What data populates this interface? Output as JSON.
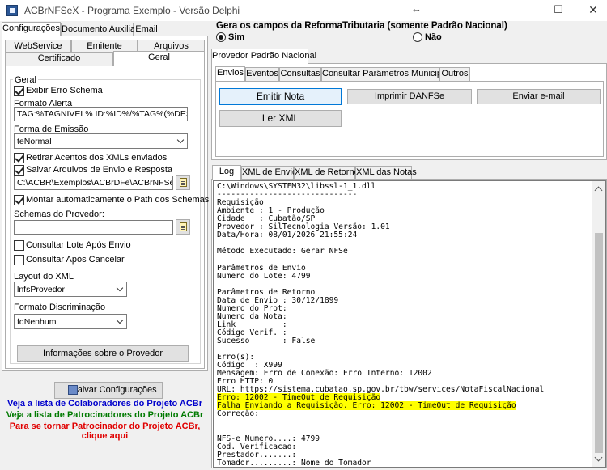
{
  "window": {
    "title": "ACBrNFSeX - Programa Exemplo - Versão Delphi",
    "resize_glyph": "↔",
    "minimize": "—",
    "maximize": "☐",
    "close": "✕"
  },
  "left": {
    "top_tabs": [
      "Configurações",
      "Documento Auxiliar",
      "Email"
    ],
    "sub_tabs_row1": [
      "WebService",
      "Emitente",
      "Arquivos"
    ],
    "sub_tabs_row2": [
      "Certificado",
      "Geral"
    ],
    "group_title": "Geral",
    "exibir_erro_schema": "Exibir Erro Schema",
    "formato_alerta_label": "Formato Alerta",
    "formato_alerta_value": "TAG:%TAGNIVEL% ID:%ID%/%TAG%(%DESCRI",
    "forma_emissao_label": "Forma de Emissão",
    "forma_emissao_value": "teNormal",
    "retirar_acentos": "Retirar Acentos dos XMLs enviados",
    "salvar_arquivos": "Salvar Arquivos de Envio e Resposta",
    "path_value": "C:\\ACBR\\Exemplos\\ACBrDFe\\ACBrNFSeX\\Delp",
    "montar_path": "Montar automaticamente o Path dos Schemas",
    "schemas_label": "Schemas do Provedor:",
    "schemas_value": "",
    "consultar_lote": "Consultar Lote Após Envio",
    "consultar_apos_cancelar": "Consultar Após Cancelar",
    "layout_xml_label": "Layout do XML",
    "layout_xml_value": "lnfsProvedor",
    "formato_discriminacao_label": "Formato Discriminação",
    "formato_discriminacao_value": "fdNenhum",
    "info_provedor_button": "Informações sobre o Provedor",
    "salvar_config_button": "Salvar Configurações",
    "link_colaboradores": "Veja a lista de Colaboradores do Projeto ACBr",
    "link_patrocinadores": "Veja a lista de Patrocinadores do Projeto ACBr",
    "link_patrocinador_1": "Para se tornar Patrocinador do Projeto ACBr,",
    "link_patrocinador_2": "clique aqui"
  },
  "right": {
    "reforma_title": "Gera os campos da ReformaTributaria (somente Padrão Nacional)",
    "radio_sim": "Sim",
    "radio_nao": "Não",
    "provedor_tab": "Provedor Padrão Nacional",
    "action_tabs": [
      "Envios",
      "Eventos",
      "Consultas",
      "Consultar Parâmetros Municipais",
      "Outros"
    ],
    "emitir_nota": "Emitir Nota",
    "imprimir_danfse": "Imprimir DANFSe",
    "enviar_email": "Enviar e-mail",
    "ler_xml": "Ler XML",
    "log_tabs": [
      "Log",
      "XML de Envio",
      "XML de Retorno",
      "XML das Notas"
    ],
    "log_lines": [
      "C:\\Windows\\SYSTEM32\\libssl-1_1.dll",
      "------------------------------",
      "Requisição",
      "Ambiente : 1 - Produção",
      "Cidade   : Cubatão/SP",
      "Provedor : SilTecnologia Versão: 1.01",
      "Data/Hora: 08/01/2026 21:55:24",
      "",
      "Método Executado: Gerar NFSe",
      "",
      "Parâmetros de Envio",
      "Numero do Lote: 4799",
      "",
      "Parâmetros de Retorno",
      "Data de Envio : 30/12/1899",
      "Numero do Prot:",
      "Numero da Nota:",
      "Link          :",
      "Código Verif. :",
      "Sucesso       : False",
      "",
      "Erro(s):",
      "Código  : X999",
      "Mensagem: Erro de Conexão: Erro Interno: 12002",
      "Erro HTTP: 0",
      "URL: https://sistema.cubatao.sp.gov.br/tbw/services/NotaFiscalNacional",
      "Erro: 12002 - TimeOut de Requisição",
      "Falha Enviando a Requisição. Erro: 12002 - TimeOut de Requisição",
      "Correção:",
      "",
      "",
      "NFS-e Numero....: 4799",
      "Cod. Verificacao:",
      "Prestador.......:",
      "Tomador.........: Nome do Tomador"
    ],
    "highlight_color": "#ffff00"
  },
  "colors": {
    "link_blue": "#0000cc",
    "link_green": "#007a00",
    "link_red": "#e00000"
  }
}
